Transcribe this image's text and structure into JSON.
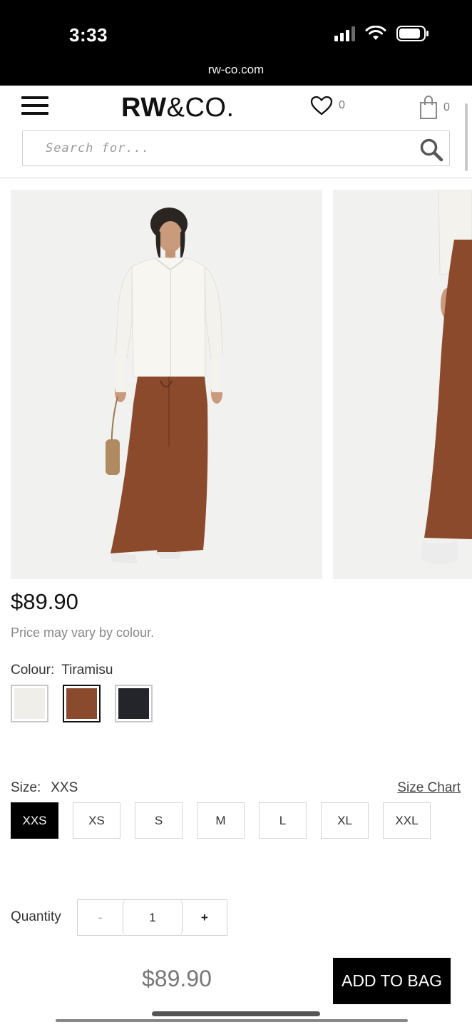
{
  "status_bar": {
    "time": "3:33",
    "url": "rw-co.com"
  },
  "header": {
    "logo_bold": "RW",
    "logo_rest": "&CO.",
    "wishlist_count": "0",
    "bag_count": "0",
    "search_placeholder": "Search for..."
  },
  "product": {
    "price": "$89.90",
    "price_note": "Price may vary by colour.",
    "colour_label": "Colour:",
    "colour_value": "Tiramisu",
    "swatches": [
      {
        "name": "white",
        "color": "#f0eee8",
        "selected": false
      },
      {
        "name": "tiramisu",
        "color": "#8a4a2e",
        "selected": true
      },
      {
        "name": "black",
        "color": "#23252b",
        "selected": false
      }
    ],
    "size_label": "Size:",
    "size_value": "XXS",
    "size_chart": "Size Chart",
    "sizes": [
      "XXS",
      "XS",
      "S",
      "M",
      "L",
      "XL",
      "XXL"
    ],
    "selected_size": "XXS",
    "quantity_label": "Quantity",
    "quantity_minus": "-",
    "quantity_value": "1",
    "quantity_plus": "+"
  },
  "footer": {
    "price": "$89.90",
    "add_to_bag": "ADD TO BAG"
  },
  "colors": {
    "pant": "#8b4a2b",
    "shirt": "#f7f6f1",
    "photo_bg": "#f1f1f0"
  }
}
